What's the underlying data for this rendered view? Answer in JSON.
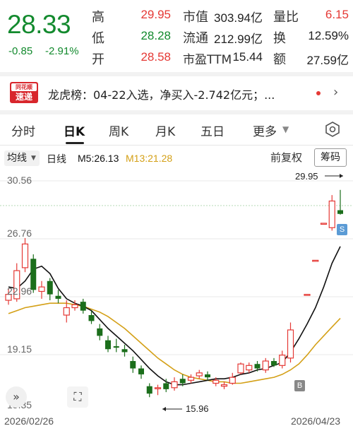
{
  "quote": {
    "price": "28.33",
    "change": "-0.85",
    "change_pct": "-2.91%",
    "stats": [
      {
        "label": "高",
        "value": "29.95",
        "color": "#e53935"
      },
      {
        "label": "低",
        "value": "28.28",
        "color": "#138a2e"
      },
      {
        "label": "开",
        "value": "28.58",
        "color": "#e53935"
      }
    ],
    "stats2": [
      {
        "label": "市值",
        "value": "303.94亿"
      },
      {
        "label": "流通",
        "value": "212.99亿"
      },
      {
        "label": "市盈TTM",
        "value": "15.44"
      }
    ],
    "stats3": [
      {
        "label": "量比",
        "value": "6.15",
        "color": "#e53935"
      },
      {
        "label": "换",
        "value": "12.59%",
        "color": "#222222"
      },
      {
        "label": "额",
        "value": "27.59亿",
        "color": "#222222"
      }
    ]
  },
  "news": {
    "logo_top": "同花顺",
    "logo_bottom": "速递",
    "text": "龙虎榜：04-22入选，净买入-2.742亿元；..."
  },
  "tabs": [
    "分时",
    "日K",
    "周K",
    "月K",
    "五日",
    "更多"
  ],
  "active_tab": "日K",
  "toolbar": {
    "ma_select": "均线",
    "period": "日线",
    "ma5": "M5:26.13",
    "ma13": "M13:21.28",
    "adjust": "前复权",
    "chips": "筹码"
  },
  "colors": {
    "up": "#e53935",
    "down": "#1b6e1b",
    "ma5": "#111111",
    "ma13": "#d4a017",
    "price_line": "#138a2e"
  },
  "chart_data": {
    "type": "candlestick",
    "y_ticks": [
      "30.56",
      "26.76",
      "22.96",
      "19.15",
      "15.35"
    ],
    "ylim": [
      15.35,
      30.56
    ],
    "x_labels": [
      "2026/02/26",
      "2026/04/23"
    ],
    "annotations": {
      "high": "29.95",
      "low": "15.96",
      "badge_sell": "S",
      "badge_buy": "B"
    },
    "ma5_label": "M5:26.13",
    "ma13_label": "M13:21.28",
    "candles": [
      {
        "o": 22.5,
        "c": 22.9,
        "h": 23.3,
        "l": 22.2
      },
      {
        "o": 22.6,
        "c": 24.5,
        "h": 25.0,
        "l": 22.4
      },
      {
        "o": 24.7,
        "c": 26.3,
        "h": 26.7,
        "l": 24.4
      },
      {
        "o": 25.3,
        "c": 23.2,
        "h": 25.6,
        "l": 23.0
      },
      {
        "o": 23.1,
        "c": 23.4,
        "h": 23.8,
        "l": 22.6
      },
      {
        "o": 23.8,
        "c": 22.9,
        "h": 24.0,
        "l": 22.5
      },
      {
        "o": 22.8,
        "c": 22.6,
        "h": 23.2,
        "l": 22.3
      },
      {
        "o": 21.5,
        "c": 22.0,
        "h": 22.5,
        "l": 21.0
      },
      {
        "o": 22.0,
        "c": 22.2,
        "h": 22.5,
        "l": 21.8
      },
      {
        "o": 22.4,
        "c": 21.8,
        "h": 22.6,
        "l": 21.6
      },
      {
        "o": 21.5,
        "c": 21.1,
        "h": 21.8,
        "l": 20.9
      },
      {
        "o": 20.6,
        "c": 20.1,
        "h": 20.9,
        "l": 19.8
      },
      {
        "o": 19.8,
        "c": 19.2,
        "h": 20.1,
        "l": 19.0
      },
      {
        "o": 19.4,
        "c": 19.3,
        "h": 19.9,
        "l": 19.0
      },
      {
        "o": 19.2,
        "c": 19.0,
        "h": 19.5,
        "l": 18.7
      },
      {
        "o": 18.4,
        "c": 17.9,
        "h": 18.7,
        "l": 17.6
      },
      {
        "o": 17.9,
        "c": 17.5,
        "h": 18.1,
        "l": 17.2
      },
      {
        "o": 16.7,
        "c": 16.2,
        "h": 16.9,
        "l": 15.96
      },
      {
        "o": 16.6,
        "c": 16.6,
        "h": 16.8,
        "l": 16.1
      },
      {
        "o": 16.9,
        "c": 16.5,
        "h": 17.2,
        "l": 16.3
      },
      {
        "o": 16.6,
        "c": 17.0,
        "h": 17.3,
        "l": 16.4
      },
      {
        "o": 17.2,
        "c": 16.9,
        "h": 17.5,
        "l": 16.7
      },
      {
        "o": 17.1,
        "c": 17.3,
        "h": 17.5,
        "l": 16.9
      },
      {
        "o": 17.4,
        "c": 17.6,
        "h": 17.8,
        "l": 17.2
      },
      {
        "o": 17.5,
        "c": 17.3,
        "h": 17.7,
        "l": 17.1
      },
      {
        "o": 16.9,
        "c": 17.1,
        "h": 17.3,
        "l": 16.7
      },
      {
        "o": 16.7,
        "c": 16.8,
        "h": 17.0,
        "l": 16.5
      },
      {
        "o": 16.9,
        "c": 17.3,
        "h": 17.6,
        "l": 16.8
      },
      {
        "o": 17.6,
        "c": 18.2,
        "h": 18.3,
        "l": 17.5
      },
      {
        "o": 17.8,
        "c": 18.1,
        "h": 18.3,
        "l": 17.6
      },
      {
        "o": 18.2,
        "c": 17.9,
        "h": 18.4,
        "l": 17.7
      },
      {
        "o": 17.8,
        "c": 18.4,
        "h": 18.6,
        "l": 17.6
      },
      {
        "o": 18.4,
        "c": 18.1,
        "h": 18.6,
        "l": 18.0
      },
      {
        "o": 18.1,
        "c": 18.8,
        "h": 19.1,
        "l": 17.9
      },
      {
        "o": 18.6,
        "c": 20.5,
        "h": 21.0,
        "l": 18.3
      },
      {
        "o": null,
        "c": null,
        "h": null,
        "l": null
      },
      {
        "o": 22.9,
        "c": 22.9,
        "h": 22.9,
        "l": 22.9
      },
      {
        "o": 25.2,
        "c": 25.2,
        "h": 25.2,
        "l": 25.2
      },
      {
        "o": 27.7,
        "c": 27.7,
        "h": 27.7,
        "l": 27.7
      },
      {
        "o": 27.4,
        "c": 29.2,
        "h": 29.6,
        "l": 27.2
      },
      {
        "o": 28.58,
        "c": 28.33,
        "h": 29.95,
        "l": 28.28
      }
    ],
    "ma5": [
      23.4,
      23.3,
      23.8,
      24.6,
      24.8,
      24.3,
      23.3,
      22.6,
      22.3,
      22.1,
      21.8,
      21.2,
      20.6,
      20.1,
      19.6,
      19.1,
      18.5,
      17.9,
      17.4,
      17.0,
      16.8,
      16.8,
      16.9,
      17.0,
      17.1,
      17.2,
      17.2,
      17.3,
      17.5,
      17.6,
      17.8,
      17.9,
      18.1,
      18.3,
      19.0,
      19.9,
      20.9,
      22.0,
      23.4,
      25.0,
      26.13
    ],
    "ma13": [
      21.6,
      21.8,
      22.0,
      22.1,
      22.2,
      22.3,
      22.3,
      22.3,
      22.2,
      22.1,
      21.9,
      21.7,
      21.4,
      21.0,
      20.6,
      20.1,
      19.6,
      19.1,
      18.6,
      18.2,
      17.8,
      17.5,
      17.3,
      17.2,
      17.1,
      17.0,
      17.0,
      16.9,
      16.9,
      17.0,
      17.1,
      17.2,
      17.3,
      17.5,
      17.8,
      18.2,
      18.8,
      19.5,
      20.1,
      20.7,
      21.28
    ]
  }
}
